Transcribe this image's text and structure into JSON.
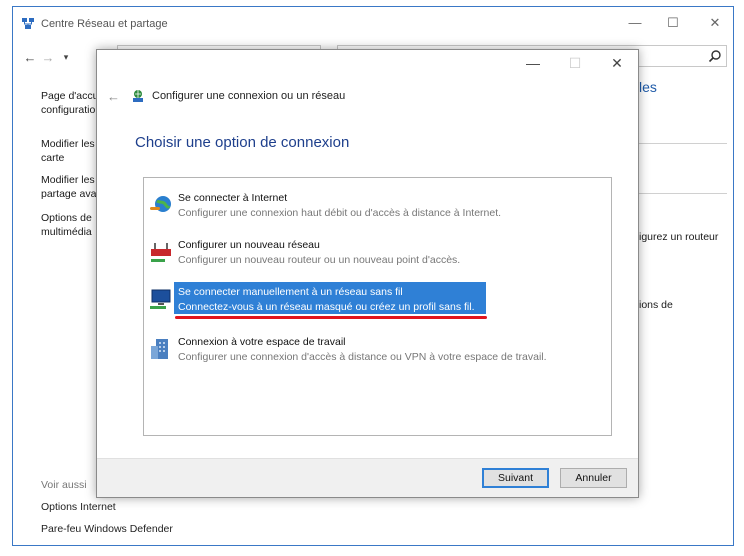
{
  "outer_window": {
    "title": "Centre Réseau et partage",
    "address_text": "",
    "search_placeholder": ""
  },
  "left_pane": {
    "links": [
      "Page d'accu configuratio",
      "Modifier les carte",
      "Modifier les partage ava",
      "Options de multimédia"
    ],
    "see_also_heading": "Voir aussi",
    "see_also_links": [
      "Options Internet",
      "Pare-feu Windows Defender"
    ]
  },
  "right_pane": {
    "title_fragment": "les",
    "text1": "igurez un routeur",
    "text2": "ions de"
  },
  "dialog": {
    "header_title": "Configurer une connexion ou un réseau",
    "heading": "Choisir une option de connexion",
    "options": [
      {
        "title": "Se connecter à Internet",
        "description": "Configurer une connexion haut débit ou d'accès à distance à Internet.",
        "icon": "internet-globe-icon",
        "selected": false
      },
      {
        "title": "Configurer un nouveau réseau",
        "description": "Configurer un nouveau routeur ou un nouveau point d'accès.",
        "icon": "router-icon",
        "selected": false
      },
      {
        "title": "Se connecter manuellement à un réseau sans fil",
        "description": "Connectez-vous à un réseau masqué ou créez un profil sans fil.",
        "icon": "wireless-network-icon",
        "selected": true
      },
      {
        "title": "Connexion à votre espace de travail",
        "description": "Configurer une connexion d'accès à distance ou VPN à votre espace de travail.",
        "icon": "workplace-building-icon",
        "selected": false
      }
    ],
    "next_label": "Suivant",
    "cancel_label": "Annuler"
  },
  "colors": {
    "selection": "#2f80d6",
    "annotation_underline": "#e0141e",
    "heading": "#1e3f8c",
    "window_border": "#3a78c6"
  }
}
